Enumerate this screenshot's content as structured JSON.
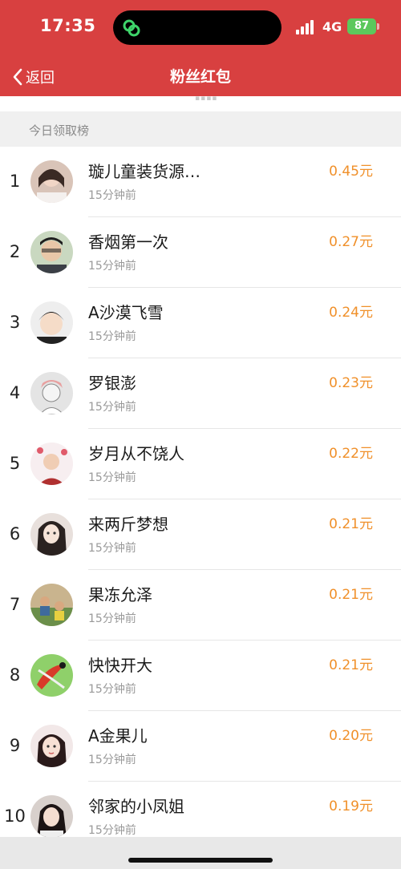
{
  "status_bar": {
    "time": "17:35",
    "network": "4G",
    "battery": "87"
  },
  "nav": {
    "back_label": "返回",
    "title": "粉丝红包"
  },
  "section": {
    "title": "今日领取榜"
  },
  "list": [
    {
      "rank": "1",
      "name": "璇儿童装货源…",
      "time": "15分钟前",
      "amount": "0.45元"
    },
    {
      "rank": "2",
      "name": "香烟第一次",
      "time": "15分钟前",
      "amount": "0.27元"
    },
    {
      "rank": "3",
      "name": "A沙漠飞雪",
      "time": "15分钟前",
      "amount": "0.24元"
    },
    {
      "rank": "4",
      "name": "罗银澎",
      "time": "15分钟前",
      "amount": "0.23元"
    },
    {
      "rank": "5",
      "name": "岁月从不饶人",
      "time": "15分钟前",
      "amount": "0.22元"
    },
    {
      "rank": "6",
      "name": "来两斤梦想",
      "time": "15分钟前",
      "amount": "0.21元"
    },
    {
      "rank": "7",
      "name": "果冻允泽",
      "time": "15分钟前",
      "amount": "0.21元"
    },
    {
      "rank": "8",
      "name": "快快开大",
      "time": "15分钟前",
      "amount": "0.21元"
    },
    {
      "rank": "9",
      "name": "A金果儿",
      "time": "15分钟前",
      "amount": "0.20元"
    },
    {
      "rank": "10",
      "name": "邻家的小凤姐",
      "time": "15分钟前",
      "amount": "0.19元"
    }
  ],
  "colors": {
    "header_bg": "#d84040",
    "amount": "#f0902a",
    "battery": "#5cc85c"
  }
}
